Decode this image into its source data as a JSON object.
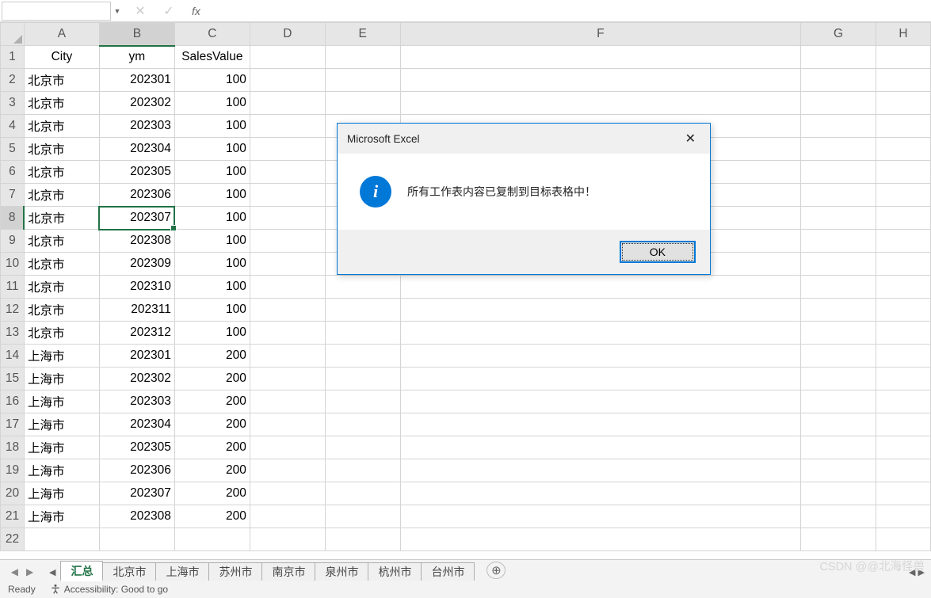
{
  "formula_bar": {
    "name_box": "",
    "formula": ""
  },
  "columns": [
    "A",
    "B",
    "C",
    "D",
    "E",
    "F",
    "G",
    "H"
  ],
  "header_row": {
    "City": "City",
    "ym": "ym",
    "SalesValue": "SalesValue"
  },
  "rows": [
    {
      "city": "北京市",
      "ym": "202301",
      "val": "100"
    },
    {
      "city": "北京市",
      "ym": "202302",
      "val": "100"
    },
    {
      "city": "北京市",
      "ym": "202303",
      "val": "100"
    },
    {
      "city": "北京市",
      "ym": "202304",
      "val": "100"
    },
    {
      "city": "北京市",
      "ym": "202305",
      "val": "100"
    },
    {
      "city": "北京市",
      "ym": "202306",
      "val": "100"
    },
    {
      "city": "北京市",
      "ym": "202307",
      "val": "100"
    },
    {
      "city": "北京市",
      "ym": "202308",
      "val": "100"
    },
    {
      "city": "北京市",
      "ym": "202309",
      "val": "100"
    },
    {
      "city": "北京市",
      "ym": "202310",
      "val": "100"
    },
    {
      "city": "北京市",
      "ym": "202311",
      "val": "100"
    },
    {
      "city": "北京市",
      "ym": "202312",
      "val": "100"
    },
    {
      "city": "上海市",
      "ym": "202301",
      "val": "200"
    },
    {
      "city": "上海市",
      "ym": "202302",
      "val": "200"
    },
    {
      "city": "上海市",
      "ym": "202303",
      "val": "200"
    },
    {
      "city": "上海市",
      "ym": "202304",
      "val": "200"
    },
    {
      "city": "上海市",
      "ym": "202305",
      "val": "200"
    },
    {
      "city": "上海市",
      "ym": "202306",
      "val": "200"
    },
    {
      "city": "上海市",
      "ym": "202307",
      "val": "200"
    },
    {
      "city": "上海市",
      "ym": "202308",
      "val": "200"
    }
  ],
  "active_cell": {
    "row": 8,
    "col": "B"
  },
  "sheet_tabs": [
    "汇总",
    "北京市",
    "上海市",
    "苏州市",
    "南京市",
    "泉州市",
    "杭州市",
    "台州市"
  ],
  "active_sheet": 0,
  "dialog": {
    "title": "Microsoft Excel",
    "message": "所有工作表内容已复制到目标表格中！",
    "ok": "OK"
  },
  "status": {
    "ready": "Ready",
    "accessibility": "Accessibility: Good to go"
  },
  "watermark": "CSDN @@北海怪兽"
}
